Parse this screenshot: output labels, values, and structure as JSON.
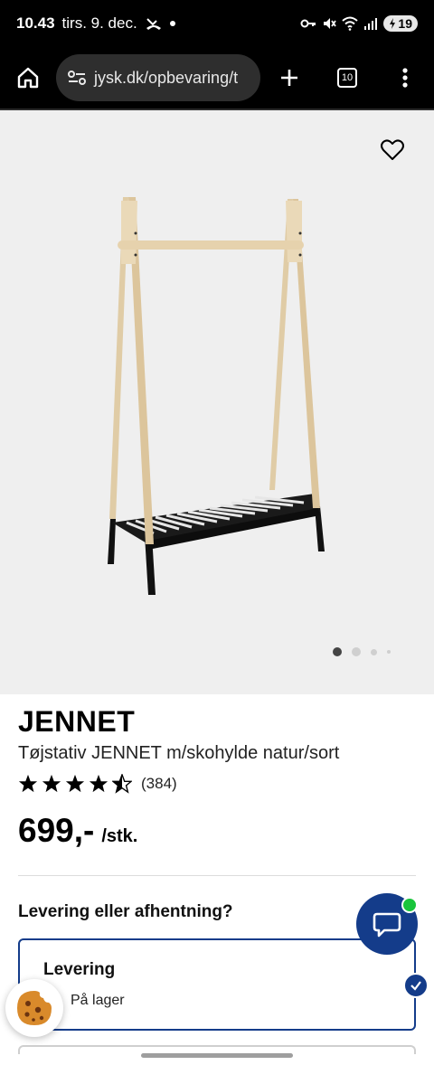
{
  "status_bar": {
    "time": "10.43",
    "date": "tirs. 9. dec.",
    "battery": "19",
    "icons": [
      "missed-call-icon",
      "dot-icon",
      "key-icon",
      "mute-icon",
      "wifi-icon",
      "signal-icon",
      "battery-icon"
    ]
  },
  "browser": {
    "url": "jysk.dk/opbevaring/t",
    "tab_count": "10",
    "icons": [
      "home-icon",
      "site-settings-icon",
      "new-tab-icon",
      "tabs-icon",
      "menu-icon"
    ]
  },
  "gallery": {
    "image": "clothes-rack-with-shoe-shelf",
    "image_count": 4,
    "active_index": 0
  },
  "product": {
    "brand": "JENNET",
    "description": "Tøjstativ JENNET m/skohylde natur/sort",
    "rating_value": 4.5,
    "rating_max": 5,
    "rating_count": "(384)",
    "price": "699,-",
    "price_unit": "/stk."
  },
  "delivery": {
    "heading": "Levering eller afhentning?",
    "option_title": "Levering",
    "stock_text": "På lager",
    "selected": true
  },
  "colors": {
    "accent": "#143c8a",
    "online": "#19c43b",
    "gallery_bg": "#efefef"
  }
}
